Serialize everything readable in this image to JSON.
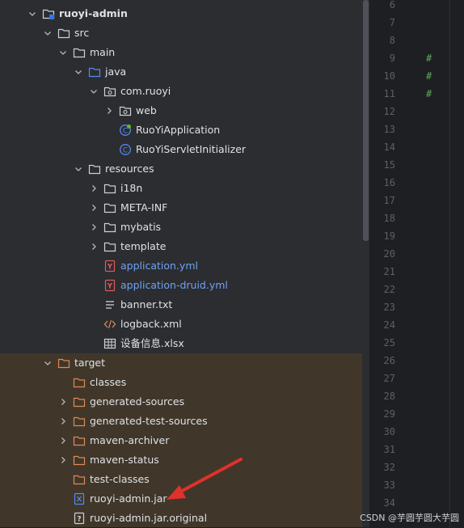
{
  "tree": [
    {
      "label": "ruoyi-admin",
      "depth": 0,
      "expander": "expanded",
      "icon": "module-folder",
      "bold": true
    },
    {
      "label": "src",
      "depth": 1,
      "expander": "expanded",
      "icon": "folder"
    },
    {
      "label": "main",
      "depth": 2,
      "expander": "expanded",
      "icon": "folder"
    },
    {
      "label": "java",
      "depth": 3,
      "expander": "expanded",
      "icon": "source-folder"
    },
    {
      "label": "com.ruoyi",
      "depth": 4,
      "expander": "expanded",
      "icon": "package"
    },
    {
      "label": "web",
      "depth": 5,
      "expander": "collapsed",
      "icon": "package"
    },
    {
      "label": "RuoYiApplication",
      "depth": 5,
      "expander": "none",
      "icon": "spring-class"
    },
    {
      "label": "RuoYiServletInitializer",
      "depth": 5,
      "expander": "none",
      "icon": "class"
    },
    {
      "label": "resources",
      "depth": 3,
      "expander": "expanded",
      "icon": "folder"
    },
    {
      "label": "i18n",
      "depth": 4,
      "expander": "collapsed",
      "icon": "folder"
    },
    {
      "label": "META-INF",
      "depth": 4,
      "expander": "collapsed",
      "icon": "folder"
    },
    {
      "label": "mybatis",
      "depth": 4,
      "expander": "collapsed",
      "icon": "folder"
    },
    {
      "label": "template",
      "depth": 4,
      "expander": "collapsed",
      "icon": "folder"
    },
    {
      "label": "application.yml",
      "depth": 4,
      "expander": "none",
      "icon": "yaml",
      "blue": true
    },
    {
      "label": "application-druid.yml",
      "depth": 4,
      "expander": "none",
      "icon": "yaml",
      "blue": true
    },
    {
      "label": "banner.txt",
      "depth": 4,
      "expander": "none",
      "icon": "text"
    },
    {
      "label": "logback.xml",
      "depth": 4,
      "expander": "none",
      "icon": "xml"
    },
    {
      "label": "设备信息.xlsx",
      "depth": 4,
      "expander": "none",
      "icon": "table"
    },
    {
      "label": "target",
      "depth": 1,
      "expander": "expanded",
      "icon": "excluded-folder"
    },
    {
      "label": "classes",
      "depth": 2,
      "expander": "none",
      "icon": "excluded-folder"
    },
    {
      "label": "generated-sources",
      "depth": 2,
      "expander": "collapsed",
      "icon": "excluded-folder"
    },
    {
      "label": "generated-test-sources",
      "depth": 2,
      "expander": "collapsed",
      "icon": "excluded-folder"
    },
    {
      "label": "maven-archiver",
      "depth": 2,
      "expander": "collapsed",
      "icon": "excluded-folder"
    },
    {
      "label": "maven-status",
      "depth": 2,
      "expander": "collapsed",
      "icon": "excluded-folder"
    },
    {
      "label": "test-classes",
      "depth": 2,
      "expander": "none",
      "icon": "excluded-folder"
    },
    {
      "label": "ruoyi-admin.jar",
      "depth": 2,
      "expander": "none",
      "icon": "jar"
    },
    {
      "label": "ruoyi-admin.jar.original",
      "depth": 2,
      "expander": "none",
      "icon": "unknown-file"
    }
  ],
  "editor": {
    "line_numbers": [
      "6",
      "7",
      "8",
      "9",
      "10",
      "11",
      "12",
      "13",
      "14",
      "15",
      "16",
      "17",
      "18",
      "19",
      "20",
      "21",
      "22",
      "23",
      "24",
      "25",
      "26",
      "27",
      "28",
      "29",
      "30",
      "31",
      "32",
      "33",
      "34"
    ],
    "hash_lines": [
      "9",
      "10",
      "11"
    ],
    "hash_char": "#"
  },
  "watermark": "CSDN @芋圆芋圆大芋圆",
  "colors": {
    "tree_bg": "#2b2d30",
    "editor_bg": "#1e1f22",
    "excluded_bg": "#40372a",
    "link_blue": "#6ea2f5",
    "arrow_red": "#e0312b"
  }
}
